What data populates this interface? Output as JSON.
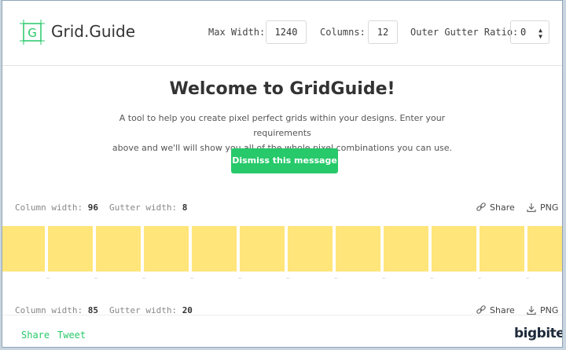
{
  "header": {
    "logo_letter": "G",
    "logo_text": "Grid.Guide",
    "max_width_label": "Max Width:",
    "max_width_value": "1240",
    "columns_label": "Columns:",
    "columns_value": "12",
    "outer_gutter_label": "Outer Gutter Ratio:",
    "outer_gutter_value": "0"
  },
  "welcome": {
    "title": "Welcome to GridGuide!",
    "line1": "A tool to help you create pixel perfect grids within your designs. Enter your requirements",
    "line2": "above and we'll will show you all of the whole pixel combinations you can use.",
    "dismiss_label": "Dismiss this message"
  },
  "grids": [
    {
      "column_width_label": "Column width:",
      "column_width": "96",
      "gutter_width_label": "Gutter width:",
      "gutter_width": "8",
      "share_label": "Share",
      "png_label": "PNG"
    },
    {
      "column_width_label": "Column width:",
      "column_width": "85",
      "gutter_width_label": "Gutter width:",
      "gutter_width": "20",
      "share_label": "Share",
      "png_label": "PNG"
    }
  ],
  "footer": {
    "share_label": "Share",
    "tweet_label": "Tweet",
    "brand": "bigbite"
  },
  "colors": {
    "accent": "#27c96a",
    "column": "#ffe57a"
  },
  "icons": {
    "share": "link-icon",
    "png": "download-icon"
  }
}
